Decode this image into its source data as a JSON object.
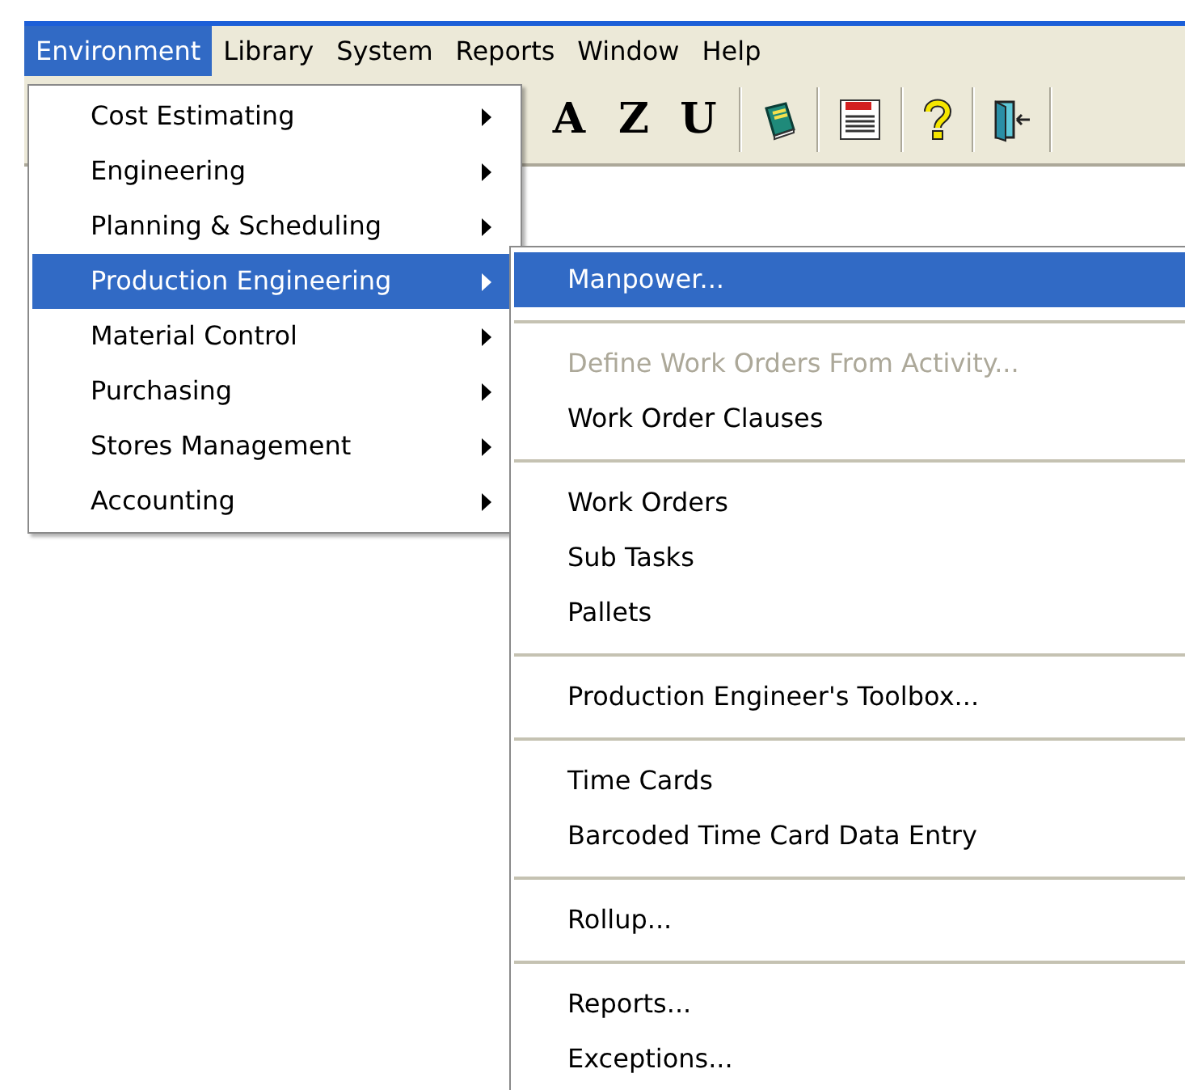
{
  "menu_bar": [
    {
      "label": "Environment",
      "selected": true
    },
    {
      "label": "Library",
      "selected": false
    },
    {
      "label": "System",
      "selected": false
    },
    {
      "label": "Reports",
      "selected": false
    },
    {
      "label": "Window",
      "selected": false
    },
    {
      "label": "Help",
      "selected": false
    }
  ],
  "toolbar": [
    {
      "kind": "letter",
      "label": "A"
    },
    {
      "kind": "letter",
      "label": "Z"
    },
    {
      "kind": "letter",
      "label": "U"
    },
    {
      "kind": "separator"
    },
    {
      "kind": "notebook"
    },
    {
      "kind": "separator"
    },
    {
      "kind": "report"
    },
    {
      "kind": "separator"
    },
    {
      "kind": "help"
    },
    {
      "kind": "separator"
    },
    {
      "kind": "exit"
    },
    {
      "kind": "separator"
    }
  ],
  "environment_menu": [
    {
      "label": "Cost Estimating",
      "selected": false
    },
    {
      "label": "Engineering",
      "selected": false
    },
    {
      "label": "Planning & Scheduling",
      "selected": false
    },
    {
      "label": "Production Engineering",
      "selected": true
    },
    {
      "label": "Material Control",
      "selected": false
    },
    {
      "label": "Purchasing",
      "selected": false
    },
    {
      "label": "Stores Management",
      "selected": false
    },
    {
      "label": "Accounting",
      "selected": false
    }
  ],
  "production_engineering_menu": [
    {
      "kind": "item",
      "label": "Manpower...",
      "selected": true,
      "disabled": false
    },
    {
      "kind": "separator"
    },
    {
      "kind": "item",
      "label": "Define Work Orders From Activity...",
      "selected": false,
      "disabled": true
    },
    {
      "kind": "item",
      "label": "Work Order Clauses",
      "selected": false,
      "disabled": false
    },
    {
      "kind": "separator"
    },
    {
      "kind": "item",
      "label": "Work Orders",
      "selected": false,
      "disabled": false
    },
    {
      "kind": "item",
      "label": "Sub Tasks",
      "selected": false,
      "disabled": false
    },
    {
      "kind": "item",
      "label": "Pallets",
      "selected": false,
      "disabled": false
    },
    {
      "kind": "separator"
    },
    {
      "kind": "item",
      "label": "Production Engineer's Toolbox...",
      "selected": false,
      "disabled": false
    },
    {
      "kind": "separator"
    },
    {
      "kind": "item",
      "label": "Time Cards",
      "selected": false,
      "disabled": false
    },
    {
      "kind": "item",
      "label": "Barcoded Time Card Data Entry",
      "selected": false,
      "disabled": false
    },
    {
      "kind": "separator"
    },
    {
      "kind": "item",
      "label": "Rollup...",
      "selected": false,
      "disabled": false
    },
    {
      "kind": "separator"
    },
    {
      "kind": "item",
      "label": "Reports...",
      "selected": false,
      "disabled": false
    },
    {
      "kind": "item",
      "label": "Exceptions...",
      "selected": false,
      "disabled": false
    }
  ]
}
